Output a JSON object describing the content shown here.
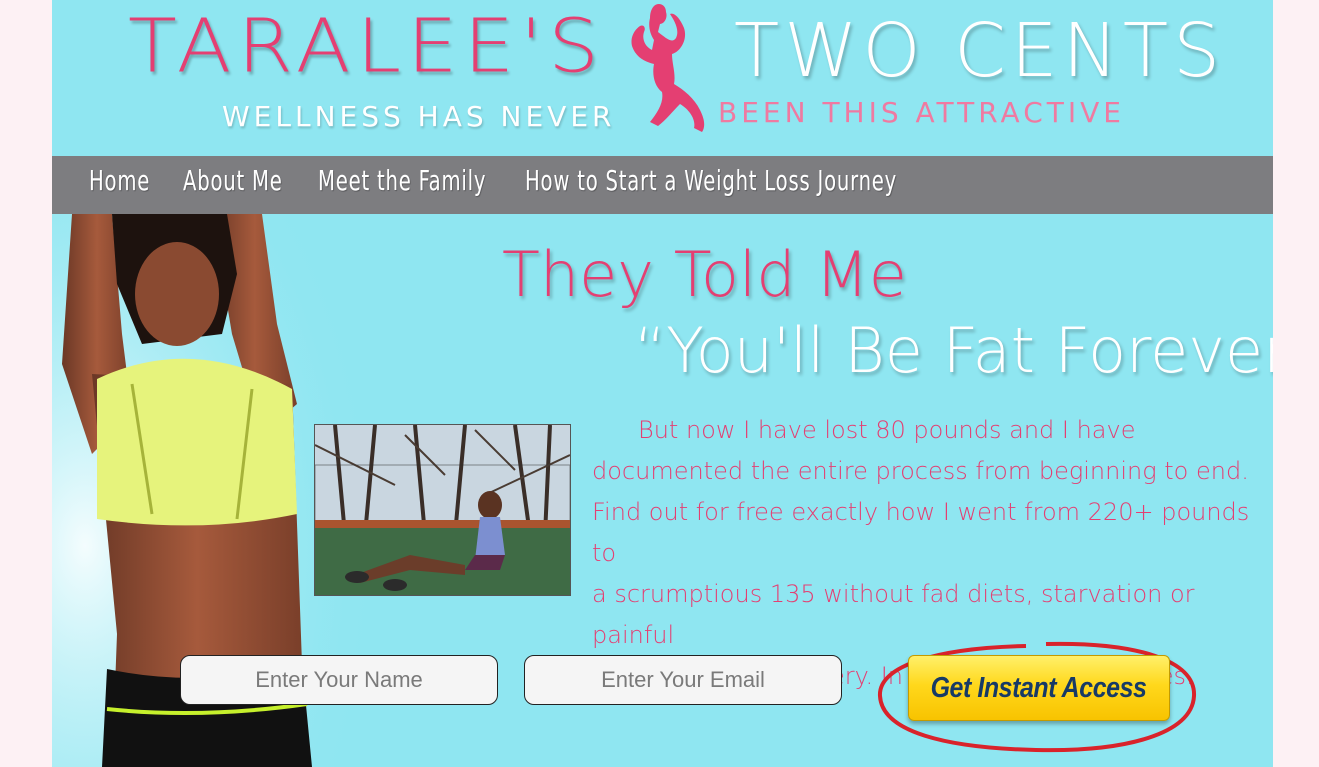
{
  "header": {
    "brand_left": "TARALEE'S",
    "brand_right": "TWO CENTS",
    "tagline_left": "WELLNESS HAS NEVER",
    "tagline_right": "BEEN THIS ATTRACTIVE",
    "logo_icon": "jumping-woman-silhouette-icon"
  },
  "nav": {
    "items": [
      {
        "label": "Home"
      },
      {
        "label": "About Me"
      },
      {
        "label": "Meet the Family"
      },
      {
        "label": "How to Start a Weight Loss Journey"
      }
    ]
  },
  "hero": {
    "headline_line1": "They Told Me",
    "headline_line2": "“You'll Be Fat Forever”",
    "body_lines": [
      "But now I have lost 80 pounds and I have",
      "documented the entire process from beginning to end.",
      "Find out for free exactly how I went from 220+ pounds to",
      "a scrumptious 135 without fad diets, starvation or painful",
      "and dangerous surgery. In this 8 part video series."
    ]
  },
  "form": {
    "name_placeholder": "Enter Your Name",
    "email_placeholder": "Enter Your Email",
    "submit_label": "Get Instant Access"
  },
  "colors": {
    "background": "#8fe6f1",
    "page_outer": "#fdf1f4",
    "pink": "#e43f72",
    "nav": "#7d7d80",
    "cta_yellow": "#ffd81c",
    "cta_text": "#173a66",
    "ring_red": "#d9232b"
  }
}
